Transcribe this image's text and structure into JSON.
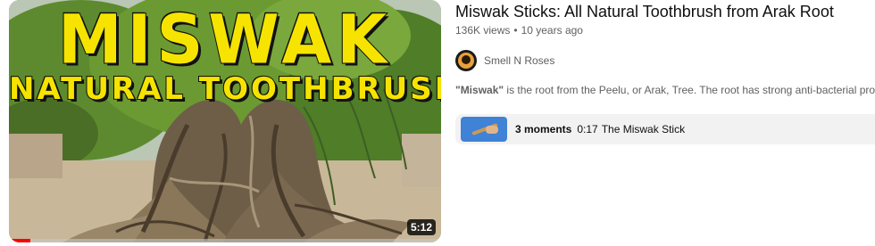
{
  "thumbnail": {
    "title_big": "MISWAK",
    "title_small": "NATURAL TOOTHBRUSH",
    "duration": "5:12",
    "progress_fraction": 0.05
  },
  "video": {
    "title": "Miswak Sticks: All Natural Toothbrush from Arak Root",
    "views": "136K views",
    "age": "10 years ago"
  },
  "channel": {
    "name": "Smell N Roses",
    "avatar_icon": "roses-logo-avatar"
  },
  "description": {
    "bold": "\"Miswak\"",
    "rest": " is the root from the Peelu, or Arak, Tree. The root has strong anti-bacterial properti"
  },
  "moments": {
    "count_label": "3 moments",
    "time": "0:17",
    "label": "The Miswak Stick"
  },
  "colors": {
    "title_yellow": "#f6e400",
    "progress_red": "#ff0000",
    "moments_bg": "#f2f2f2"
  }
}
